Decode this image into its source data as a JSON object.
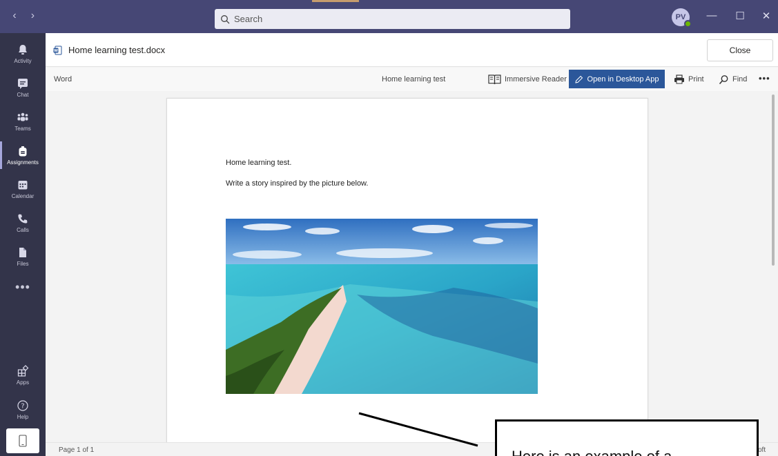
{
  "titlebar": {
    "search_placeholder": "Search",
    "avatar_initials": "PV",
    "colors": {
      "bar": "#464775",
      "rail": "#33344a",
      "accent": "#2b579a"
    }
  },
  "rail": {
    "items": [
      {
        "label": "Activity",
        "icon": "bell-icon"
      },
      {
        "label": "Chat",
        "icon": "chat-icon"
      },
      {
        "label": "Teams",
        "icon": "teams-icon"
      },
      {
        "label": "Assignments",
        "icon": "backpack-icon",
        "active": true
      },
      {
        "label": "Calendar",
        "icon": "calendar-icon"
      },
      {
        "label": "Calls",
        "icon": "phone-icon"
      },
      {
        "label": "Files",
        "icon": "file-icon"
      }
    ],
    "more": "•••",
    "apps_label": "Apps",
    "help_label": "Help"
  },
  "file_header": {
    "file_name": "Home learning test.docx",
    "close_label": "Close"
  },
  "toolbar": {
    "app_name": "Word",
    "doc_title": "Home learning test",
    "immersive_reader": "Immersive Reader",
    "open_desktop": "Open in Desktop App",
    "print": "Print",
    "find": "Find",
    "more": "•••"
  },
  "document": {
    "line1": "Home learning test.",
    "line2": "Write a story inspired by the picture below."
  },
  "statusbar": {
    "page_count": "Page 1 of 1",
    "right_text": "oft"
  },
  "annotation": {
    "text": "Here is an example of a"
  }
}
